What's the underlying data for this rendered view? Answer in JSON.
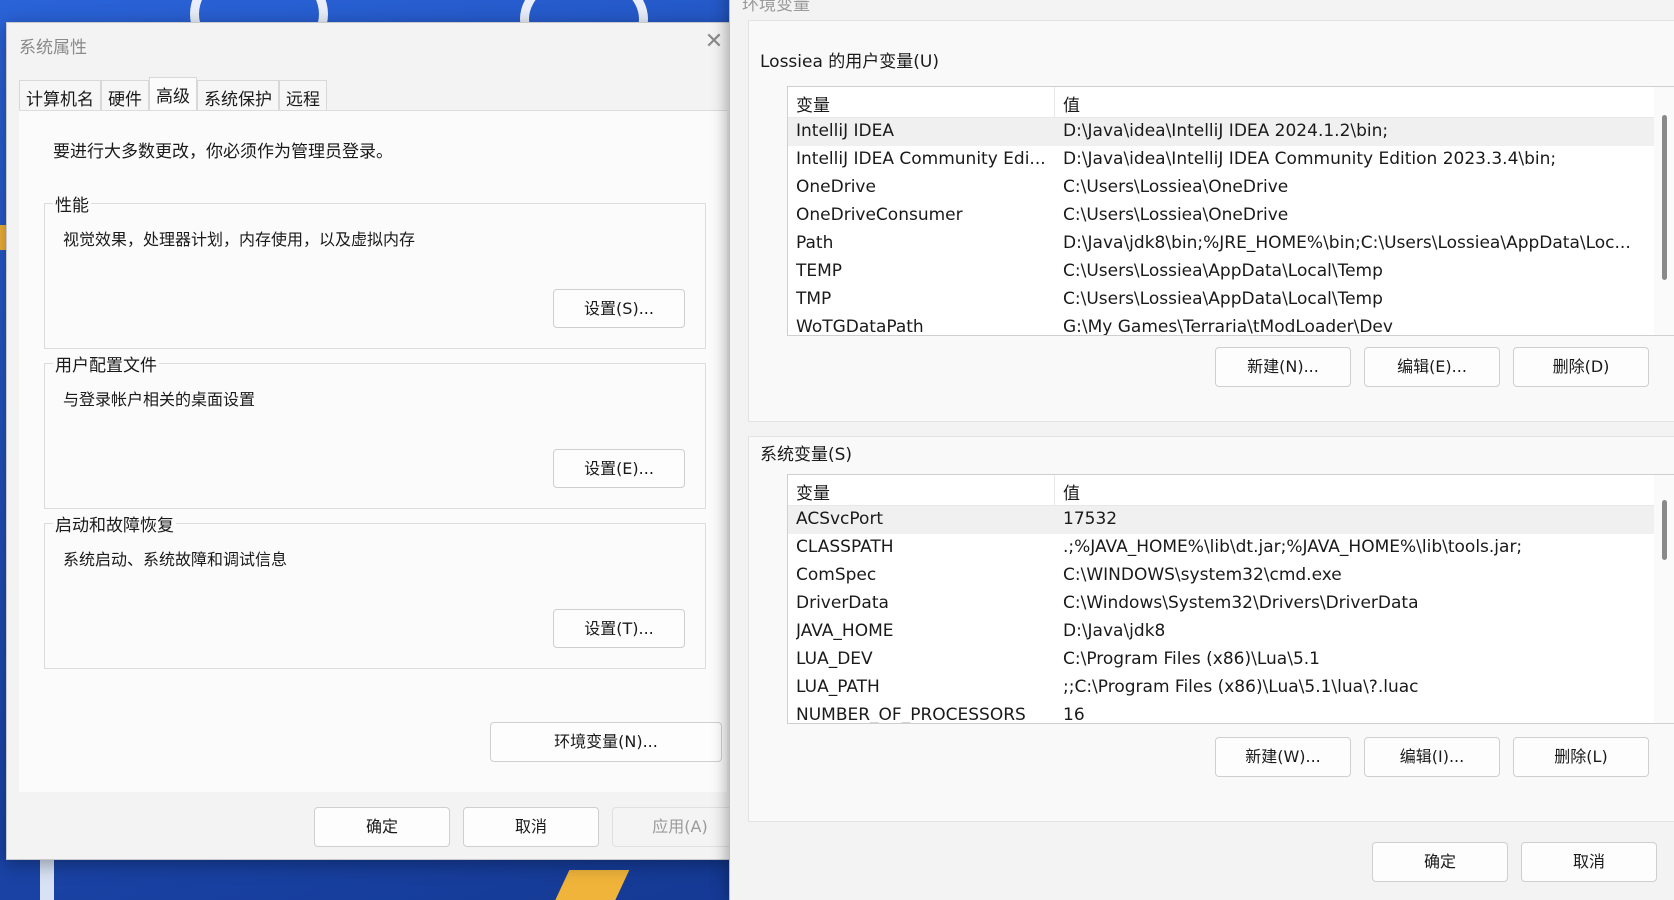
{
  "system_properties": {
    "title": "系统属性",
    "close_glyph": "✕",
    "tabs": [
      "计算机名",
      "硬件",
      "高级",
      "系统保护",
      "远程"
    ],
    "admin_note": "要进行大多数更改，你必须作为管理员登录。",
    "groups": [
      {
        "label": "性能",
        "description": "视觉效果，处理器计划，内存使用，以及虚拟内存",
        "button": "设置(S)..."
      },
      {
        "label": "用户配置文件",
        "description": "与登录帐户相关的桌面设置",
        "button": "设置(E)..."
      },
      {
        "label": "启动和故障恢复",
        "description": "系统启动、系统故障和调试信息",
        "button": "设置(T)..."
      }
    ],
    "env_button": "环境变量(N)...",
    "ok": "确定",
    "cancel": "取消",
    "apply": "应用(A)"
  },
  "environment_variables": {
    "title": "环境变量",
    "user_section": {
      "label": "Lossiea 的用户变量(U)",
      "col_variable": "变量",
      "col_value": "值",
      "rows": [
        {
          "name": "IntelliJ IDEA",
          "value": "D:\\Java\\idea\\IntelliJ IDEA 2024.1.2\\bin;"
        },
        {
          "name": "IntelliJ IDEA Community Edi...",
          "value": "D:\\Java\\idea\\IntelliJ IDEA Community Edition 2023.3.4\\bin;"
        },
        {
          "name": "OneDrive",
          "value": "C:\\Users\\Lossiea\\OneDrive"
        },
        {
          "name": "OneDriveConsumer",
          "value": "C:\\Users\\Lossiea\\OneDrive"
        },
        {
          "name": "Path",
          "value": "D:\\Java\\jdk8\\bin;%JRE_HOME%\\bin;C:\\Users\\Lossiea\\AppData\\Loc..."
        },
        {
          "name": "TEMP",
          "value": "C:\\Users\\Lossiea\\AppData\\Local\\Temp"
        },
        {
          "name": "TMP",
          "value": "C:\\Users\\Lossiea\\AppData\\Local\\Temp"
        },
        {
          "name": "WoTGDataPath",
          "value": "G:\\My Games\\Terraria\\tModLoader\\Dev"
        }
      ],
      "new": "新建(N)...",
      "edit": "编辑(E)...",
      "delete": "删除(D)"
    },
    "system_section": {
      "label": "系统变量(S)",
      "col_variable": "变量",
      "col_value": "值",
      "rows": [
        {
          "name": "ACSvcPort",
          "value": "17532"
        },
        {
          "name": "CLASSPATH",
          "value": ".;%JAVA_HOME%\\lib\\dt.jar;%JAVA_HOME%\\lib\\tools.jar;"
        },
        {
          "name": "ComSpec",
          "value": "C:\\WINDOWS\\system32\\cmd.exe"
        },
        {
          "name": "DriverData",
          "value": "C:\\Windows\\System32\\Drivers\\DriverData"
        },
        {
          "name": "JAVA_HOME",
          "value": "D:\\Java\\jdk8"
        },
        {
          "name": "LUA_DEV",
          "value": "C:\\Program Files (x86)\\Lua\\5.1"
        },
        {
          "name": "LUA_PATH",
          "value": ";;C:\\Program Files (x86)\\Lua\\5.1\\lua\\?.luac"
        },
        {
          "name": "NUMBER_OF_PROCESSORS",
          "value": "16"
        }
      ],
      "new": "新建(W)...",
      "edit": "编辑(I)...",
      "delete": "删除(L)"
    },
    "ok": "确定",
    "cancel": "取消"
  },
  "colors": {
    "accent": "#1a44a8",
    "dialog_bg": "#f3f3f3",
    "selected_row": "#f0f0f0"
  }
}
